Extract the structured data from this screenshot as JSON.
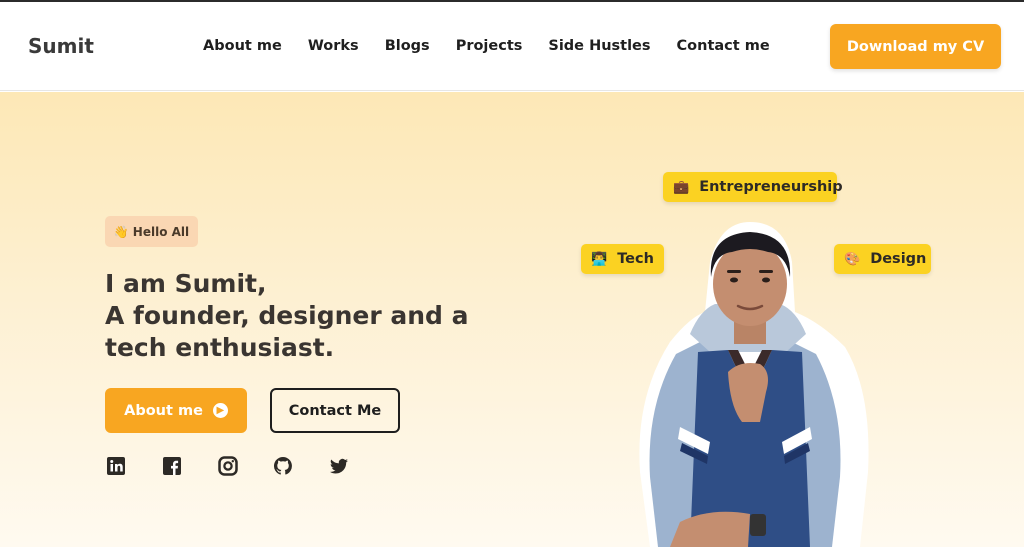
{
  "nav": {
    "brand": "Sumit",
    "links": [
      "About me",
      "Works",
      "Blogs",
      "Projects",
      "Side Hustles",
      "Contact me"
    ],
    "cta": "Download my CV"
  },
  "hero": {
    "badge_emoji": "👋",
    "badge": "Hello All",
    "headline": [
      "I am Sumit,",
      "A founder, designer and a",
      "tech enthusiast."
    ],
    "about_button": "About me",
    "contact_button": "Contact Me",
    "social": [
      "linkedin-icon",
      "facebook-icon",
      "instagram-icon",
      "github-icon",
      "twitter-icon"
    ],
    "tags": [
      {
        "emoji": "💼",
        "label": "Entrepreneurship"
      },
      {
        "emoji": "👨‍💻",
        "label": "Tech"
      },
      {
        "emoji": "🎨",
        "label": "Design"
      }
    ]
  },
  "colors": {
    "accent": "#f8a621",
    "tag": "#fbd222",
    "badge": "#fad7b3",
    "text": "#3a3531"
  }
}
